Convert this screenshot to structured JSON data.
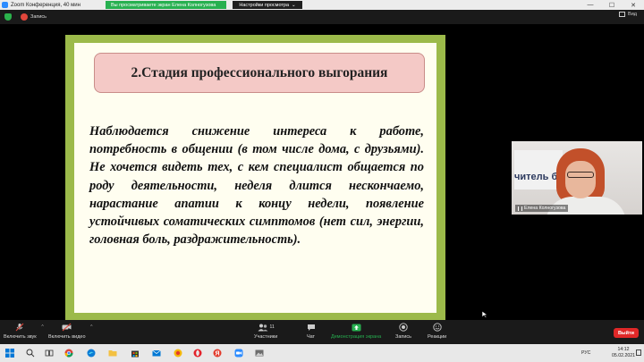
{
  "window": {
    "title": "Zoom Конференция, 40 мин",
    "window_controls": [
      "minimize-icon",
      "maximize-icon",
      "close-icon"
    ]
  },
  "share_banner": {
    "text": "Вы просматриваете экран Елена Колногузова",
    "view_options_label": "Настройки просмотра"
  },
  "topbar": {
    "recording_label": "Запись",
    "view_label": "Вид"
  },
  "slide": {
    "heading": "2.Стадия профессионального выгорания",
    "body": "Наблюдается снижение интереса к работе, потребность в общении (в том числе дома, с друзьями). Не хочется видеть тех, с кем специалист общается по роду деятельности, неделя длится нескончаемо, нарастание апатии к концу недели, появление устойчивых соматических симптомов (нет сил, энергии, головная боль, раздражительность)."
  },
  "video_tile": {
    "participant_name": "Елена Колногузова",
    "background_text": "читель б"
  },
  "controls": {
    "audio_label": "Включить звук",
    "video_label": "Включить видео",
    "participants_label": "Участники",
    "participants_count": "11",
    "chat_label": "Чат",
    "share_label": "Демонстрация экрана",
    "record_label": "Запись",
    "reactions_label": "Реакции",
    "exit_label": "Выйти"
  },
  "colors": {
    "share_green": "#27b050",
    "exit_red": "#e02828",
    "slide_frame": "#9cba4a",
    "heading_box": "#f4c9c6"
  },
  "taskbar": {
    "time": "14:12",
    "date": "05.02.2021",
    "language": "РУС"
  }
}
